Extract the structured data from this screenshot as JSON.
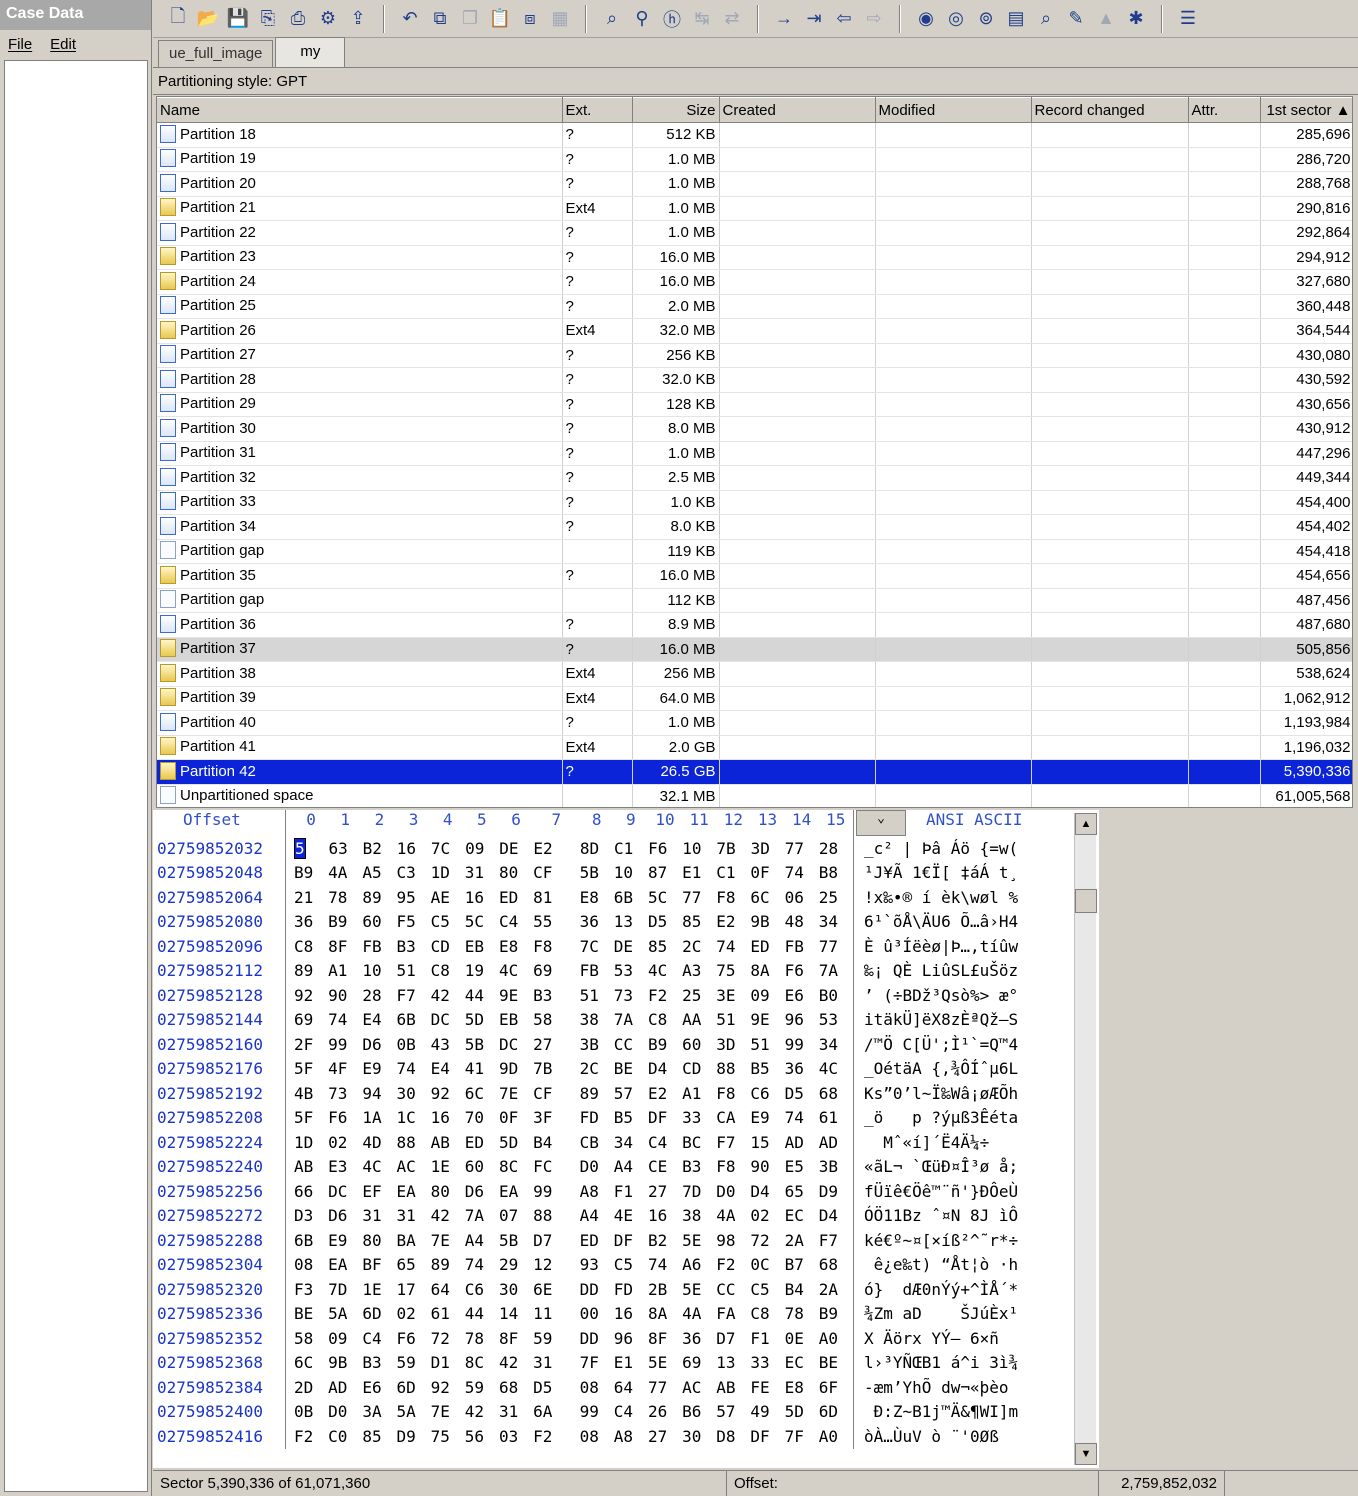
{
  "left_panel": {
    "title": "Case Data",
    "menu": [
      "File",
      "Edit"
    ]
  },
  "toolbar": {
    "icons": [
      "new-file-icon",
      "open-icon",
      "save-icon",
      "save-all-icon",
      "print-icon",
      "properties-icon",
      "export-icon",
      "sep",
      "undo-icon",
      "copy-icon",
      "copy-special-icon",
      "paste-icon",
      "paste-special-icon",
      "binary-icon",
      "sep",
      "find-icon",
      "find-hex-icon",
      "hex-icon",
      "replace-icon",
      "replace-hex-icon",
      "sep",
      "goto-offset-icon",
      "goto-sector-icon",
      "back-icon",
      "forward-icon",
      "sep",
      "disk-icon",
      "disk-open-icon",
      "disk-clone-icon",
      "ram-icon",
      "search-icon",
      "tools-icon",
      "chart-icon",
      "settings-icon",
      "sep",
      "options-icon"
    ]
  },
  "tabs": [
    "ue_full_image",
    "my"
  ],
  "partitioning_style": "Partitioning style: GPT",
  "table": {
    "columns": [
      "Name",
      "Ext.",
      "Size",
      "Created",
      "Modified",
      "Record changed",
      "Attr.",
      "1st sector"
    ],
    "rows": [
      {
        "name": "Partition 18",
        "ext": "?",
        "size": "512 KB",
        "sector": "285,696",
        "icon": "file"
      },
      {
        "name": "Partition 19",
        "ext": "?",
        "size": "1.0 MB",
        "sector": "286,720",
        "icon": "file"
      },
      {
        "name": "Partition 20",
        "ext": "?",
        "size": "1.0 MB",
        "sector": "288,768",
        "icon": "file"
      },
      {
        "name": "Partition 21",
        "ext": "Ext4",
        "size": "1.0 MB",
        "sector": "290,816",
        "icon": "fs"
      },
      {
        "name": "Partition 22",
        "ext": "?",
        "size": "1.0 MB",
        "sector": "292,864",
        "icon": "file"
      },
      {
        "name": "Partition 23",
        "ext": "?",
        "size": "16.0 MB",
        "sector": "294,912",
        "icon": "fs"
      },
      {
        "name": "Partition 24",
        "ext": "?",
        "size": "16.0 MB",
        "sector": "327,680",
        "icon": "fs"
      },
      {
        "name": "Partition 25",
        "ext": "?",
        "size": "2.0 MB",
        "sector": "360,448",
        "icon": "file"
      },
      {
        "name": "Partition 26",
        "ext": "Ext4",
        "size": "32.0 MB",
        "sector": "364,544",
        "icon": "fs"
      },
      {
        "name": "Partition 27",
        "ext": "?",
        "size": "256 KB",
        "sector": "430,080",
        "icon": "file"
      },
      {
        "name": "Partition 28",
        "ext": "?",
        "size": "32.0 KB",
        "sector": "430,592",
        "icon": "file"
      },
      {
        "name": "Partition 29",
        "ext": "?",
        "size": "128 KB",
        "sector": "430,656",
        "icon": "file"
      },
      {
        "name": "Partition 30",
        "ext": "?",
        "size": "8.0 MB",
        "sector": "430,912",
        "icon": "file"
      },
      {
        "name": "Partition 31",
        "ext": "?",
        "size": "1.0 MB",
        "sector": "447,296",
        "icon": "file"
      },
      {
        "name": "Partition 32",
        "ext": "?",
        "size": "2.5 MB",
        "sector": "449,344",
        "icon": "file"
      },
      {
        "name": "Partition 33",
        "ext": "?",
        "size": "1.0 KB",
        "sector": "454,400",
        "icon": "file"
      },
      {
        "name": "Partition 34",
        "ext": "?",
        "size": "8.0 KB",
        "sector": "454,402",
        "icon": "file"
      },
      {
        "name": "Partition gap",
        "ext": "",
        "size": "119 KB",
        "sector": "454,418",
        "icon": "gap"
      },
      {
        "name": "Partition 35",
        "ext": "?",
        "size": "16.0 MB",
        "sector": "454,656",
        "icon": "fs"
      },
      {
        "name": "Partition gap",
        "ext": "",
        "size": "112 KB",
        "sector": "487,456",
        "icon": "gap"
      },
      {
        "name": "Partition 36",
        "ext": "?",
        "size": "8.9 MB",
        "sector": "487,680",
        "icon": "file"
      },
      {
        "name": "Partition 37",
        "ext": "?",
        "size": "16.0 MB",
        "sector": "505,856",
        "icon": "fs",
        "state": "hl"
      },
      {
        "name": "Partition 38",
        "ext": "Ext4",
        "size": "256 MB",
        "sector": "538,624",
        "icon": "fs"
      },
      {
        "name": "Partition 39",
        "ext": "Ext4",
        "size": "64.0 MB",
        "sector": "1,062,912",
        "icon": "fs"
      },
      {
        "name": "Partition 40",
        "ext": "?",
        "size": "1.0 MB",
        "sector": "1,193,984",
        "icon": "file"
      },
      {
        "name": "Partition 41",
        "ext": "Ext4",
        "size": "2.0 GB",
        "sector": "1,196,032",
        "icon": "fs"
      },
      {
        "name": "Partition 42",
        "ext": "?",
        "size": "26.5 GB",
        "sector": "5,390,336",
        "icon": "fs",
        "state": "sel"
      },
      {
        "name": "Unpartitioned space",
        "ext": "",
        "size": "32.1 MB",
        "sector": "61,005,568",
        "icon": "gap"
      }
    ]
  },
  "hex": {
    "offset_label": "Offset",
    "col_labels": [
      "0",
      "1",
      "2",
      "3",
      "4",
      "5",
      "6",
      "7",
      "8",
      "9",
      "10",
      "11",
      "12",
      "13",
      "14",
      "15"
    ],
    "charset_labels": "ANSI ASCII",
    "rows": [
      {
        "o": "02759852032",
        "b": [
          "5F",
          "63",
          "B2",
          "16",
          "7C",
          "09",
          "DE",
          "E2",
          "8D",
          "C1",
          "F6",
          "10",
          "7B",
          "3D",
          "77",
          "28"
        ],
        "a": "_c² | Þâ Áö {=w("
      },
      {
        "o": "02759852048",
        "b": [
          "B9",
          "4A",
          "A5",
          "C3",
          "1D",
          "31",
          "80",
          "CF",
          "5B",
          "10",
          "87",
          "E1",
          "C1",
          "0F",
          "74",
          "B8"
        ],
        "a": "¹J¥Ã 1€Ï[ ‡áÁ t¸"
      },
      {
        "o": "02759852064",
        "b": [
          "21",
          "78",
          "89",
          "95",
          "AE",
          "16",
          "ED",
          "81",
          "E8",
          "6B",
          "5C",
          "77",
          "F8",
          "6C",
          "06",
          "25"
        ],
        "a": "!x‰•® í èk\\wøl %"
      },
      {
        "o": "02759852080",
        "b": [
          "36",
          "B9",
          "60",
          "F5",
          "C5",
          "5C",
          "C4",
          "55",
          "36",
          "13",
          "D5",
          "85",
          "E2",
          "9B",
          "48",
          "34"
        ],
        "a": "6¹`õÅ\\ÄU6 Õ…â›H4"
      },
      {
        "o": "02759852096",
        "b": [
          "C8",
          "8F",
          "FB",
          "B3",
          "CD",
          "EB",
          "E8",
          "F8",
          "7C",
          "DE",
          "85",
          "2C",
          "74",
          "ED",
          "FB",
          "77"
        ],
        "a": "È û³Íëèø|Þ…,tíûw"
      },
      {
        "o": "02759852112",
        "b": [
          "89",
          "A1",
          "10",
          "51",
          "C8",
          "19",
          "4C",
          "69",
          "FB",
          "53",
          "4C",
          "A3",
          "75",
          "8A",
          "F6",
          "7A"
        ],
        "a": "‰¡ QÈ LiûSL£uŠöz"
      },
      {
        "o": "02759852128",
        "b": [
          "92",
          "90",
          "28",
          "F7",
          "42",
          "44",
          "9E",
          "B3",
          "51",
          "73",
          "F2",
          "25",
          "3E",
          "09",
          "E6",
          "B0"
        ],
        "a": "’ (÷BDž³Qsò%> æ°"
      },
      {
        "o": "02759852144",
        "b": [
          "69",
          "74",
          "E4",
          "6B",
          "DC",
          "5D",
          "EB",
          "58",
          "38",
          "7A",
          "C8",
          "AA",
          "51",
          "9E",
          "96",
          "53"
        ],
        "a": "itäkÜ]ëX8zÈªQž–S"
      },
      {
        "o": "02759852160",
        "b": [
          "2F",
          "99",
          "D6",
          "0B",
          "43",
          "5B",
          "DC",
          "27",
          "3B",
          "CC",
          "B9",
          "60",
          "3D",
          "51",
          "99",
          "34"
        ],
        "a": "/™Ö C[Ü';Ì¹`=Q™4"
      },
      {
        "o": "02759852176",
        "b": [
          "5F",
          "4F",
          "E9",
          "74",
          "E4",
          "41",
          "9D",
          "7B",
          "2C",
          "BE",
          "D4",
          "CD",
          "88",
          "B5",
          "36",
          "4C"
        ],
        "a": "_OétäA {,¾ÔÍˆµ6L"
      },
      {
        "o": "02759852192",
        "b": [
          "4B",
          "73",
          "94",
          "30",
          "92",
          "6C",
          "7E",
          "CF",
          "89",
          "57",
          "E2",
          "A1",
          "F8",
          "C6",
          "D5",
          "68"
        ],
        "a": "Ks”0’l~Ï‰Wâ¡øÆÕh"
      },
      {
        "o": "02759852208",
        "b": [
          "5F",
          "F6",
          "1A",
          "1C",
          "16",
          "70",
          "0F",
          "3F",
          "FD",
          "B5",
          "DF",
          "33",
          "CA",
          "E9",
          "74",
          "61"
        ],
        "a": "_ö   p ?ýµß3Êéta"
      },
      {
        "o": "02759852224",
        "b": [
          "1D",
          "02",
          "4D",
          "88",
          "AB",
          "ED",
          "5D",
          "B4",
          "CB",
          "34",
          "C4",
          "BC",
          "F7",
          "15",
          "AD",
          "AD"
        ],
        "a": "  Mˆ«í]´Ë4Ä¼÷ ­­"
      },
      {
        "o": "02759852240",
        "b": [
          "AB",
          "E3",
          "4C",
          "AC",
          "1E",
          "60",
          "8C",
          "FC",
          "D0",
          "A4",
          "CE",
          "B3",
          "F8",
          "90",
          "E5",
          "3B"
        ],
        "a": "«ãL¬ `ŒüÐ¤Î³ø å;"
      },
      {
        "o": "02759852256",
        "b": [
          "66",
          "DC",
          "EF",
          "EA",
          "80",
          "D6",
          "EA",
          "99",
          "A8",
          "F1",
          "27",
          "7D",
          "D0",
          "D4",
          "65",
          "D9"
        ],
        "a": "fÜïê€Öê™¨ñ'}ÐÔeÙ"
      },
      {
        "o": "02759852272",
        "b": [
          "D3",
          "D6",
          "31",
          "31",
          "42",
          "7A",
          "07",
          "88",
          "A4",
          "4E",
          "16",
          "38",
          "4A",
          "02",
          "EC",
          "D4"
        ],
        "a": "ÓÖ11Bz ˆ¤N 8J ìÔ"
      },
      {
        "o": "02759852288",
        "b": [
          "6B",
          "E9",
          "80",
          "BA",
          "7E",
          "A4",
          "5B",
          "D7",
          "ED",
          "DF",
          "B2",
          "5E",
          "98",
          "72",
          "2A",
          "F7"
        ],
        "a": "ké€º~¤[×íß²^˜r*÷"
      },
      {
        "o": "02759852304",
        "b": [
          "08",
          "EA",
          "BF",
          "65",
          "89",
          "74",
          "29",
          "12",
          "93",
          "C5",
          "74",
          "A6",
          "F2",
          "0C",
          "B7",
          "68"
        ],
        "a": " ê¿e‰t) “Åt¦ò ·h"
      },
      {
        "o": "02759852320",
        "b": [
          "F3",
          "7D",
          "1E",
          "17",
          "64",
          "C6",
          "30",
          "6E",
          "DD",
          "FD",
          "2B",
          "5E",
          "CC",
          "C5",
          "B4",
          "2A"
        ],
        "a": "ó}  dÆ0nÝý+^ÌÅ´*"
      },
      {
        "o": "02759852336",
        "b": [
          "BE",
          "5A",
          "6D",
          "02",
          "61",
          "44",
          "14",
          "11",
          "00",
          "16",
          "8A",
          "4A",
          "FA",
          "C8",
          "78",
          "B9"
        ],
        "a": "¾Zm aD    ŠJúÈx¹"
      },
      {
        "o": "02759852352",
        "b": [
          "58",
          "09",
          "C4",
          "F6",
          "72",
          "78",
          "8F",
          "59",
          "DD",
          "96",
          "8F",
          "36",
          "D7",
          "F1",
          "0E",
          "A0"
        ],
        "a": "X Äörx YÝ– 6×ñ  "
      },
      {
        "o": "02759852368",
        "b": [
          "6C",
          "9B",
          "B3",
          "59",
          "D1",
          "8C",
          "42",
          "31",
          "7F",
          "E1",
          "5E",
          "69",
          "13",
          "33",
          "EC",
          "BE"
        ],
        "a": "l›³YÑŒB1 á^i 3ì¾"
      },
      {
        "o": "02759852384",
        "b": [
          "2D",
          "AD",
          "E6",
          "6D",
          "92",
          "59",
          "68",
          "D5",
          "08",
          "64",
          "77",
          "AC",
          "AB",
          "FE",
          "E8",
          "6F"
        ],
        "a": "-­æm’YhÕ dw¬«þèo"
      },
      {
        "o": "02759852400",
        "b": [
          "0B",
          "D0",
          "3A",
          "5A",
          "7E",
          "42",
          "31",
          "6A",
          "99",
          "C4",
          "26",
          "B6",
          "57",
          "49",
          "5D",
          "6D"
        ],
        "a": " Ð:Z~B1j™Ä&¶WI]m"
      },
      {
        "o": "02759852416",
        "b": [
          "F2",
          "C0",
          "85",
          "D9",
          "75",
          "56",
          "03",
          "F2",
          "08",
          "A8",
          "27",
          "30",
          "D8",
          "DF",
          "7F",
          "A0"
        ],
        "a": "òÀ…ÙuV ò ¨'0Øß  "
      }
    ]
  },
  "status": {
    "sector": "Sector 5,390,336 of 61,071,360",
    "offset_label": "Offset:",
    "offset_value": "2,759,852,032"
  },
  "colors": {
    "selection": "#0b24d8",
    "offset_text": "#1a34c8",
    "header_text": "#3050c8"
  }
}
